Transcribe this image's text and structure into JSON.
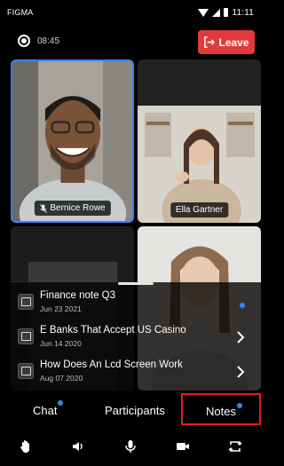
{
  "status_bar": {
    "carrier": "FIGMA",
    "time": "11:11"
  },
  "call": {
    "timer": "08:45",
    "leave_label": "Leave"
  },
  "participants": [
    {
      "name": "Bernice Rowe",
      "muted": true,
      "active_speaker": true
    },
    {
      "name": "Ella Gartner",
      "muted": false
    },
    {
      "name": "",
      "muted": false
    },
    {
      "name": "",
      "muted": false
    }
  ],
  "notes": [
    {
      "title": "Finance note Q3",
      "date": "Jun 23 2021",
      "indicator": "unread-dot"
    },
    {
      "title": "E Banks That Accept US Casino",
      "date": "Jun 14 2020",
      "indicator": "chevron-right"
    },
    {
      "title": "How Does An Lcd Screen Work",
      "date": "Aug 07 2020",
      "indicator": "chevron-right"
    }
  ],
  "tabs": {
    "chat": "Chat",
    "participants": "Participants",
    "notes": "Notes"
  },
  "toolbar": [
    "raise-hand-icon",
    "speaker-icon",
    "microphone-icon",
    "video-camera-icon",
    "switch-camera-icon"
  ],
  "colors": {
    "accent": "#3b82f6",
    "leave": "#e23a3a",
    "highlight": "#e01e1e"
  }
}
